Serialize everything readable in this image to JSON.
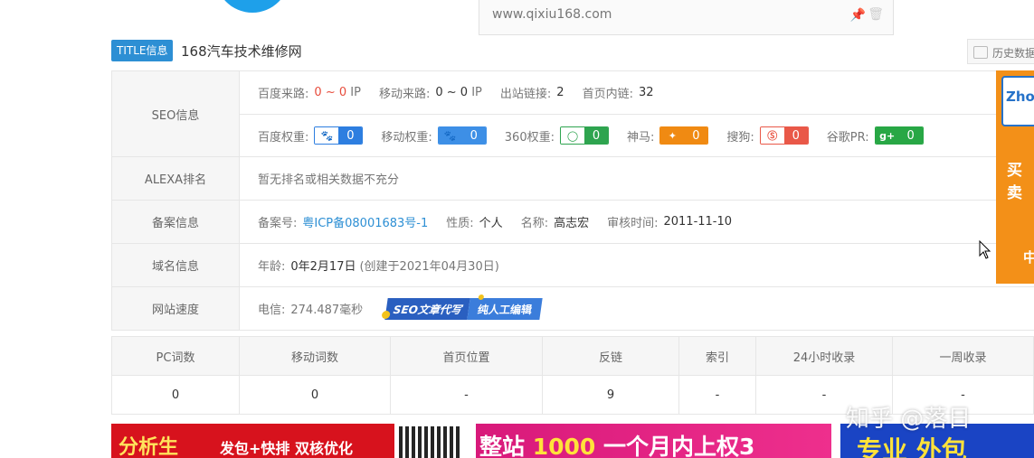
{
  "topbar": {
    "url": "www.qixiu168.com",
    "history_label": "历史数据"
  },
  "title_section": {
    "badge": "TITLE信息",
    "title": "168汽车技术维修网"
  },
  "seo": {
    "label": "SEO信息",
    "baidu_source_label": "百度来路:",
    "baidu_source_from": "0",
    "baidu_source_sep": "~",
    "baidu_source_to": "0",
    "baidu_source_unit": "IP",
    "mobile_source_label": "移动来路:",
    "mobile_source_value": "0 ~ 0",
    "mobile_source_unit": "IP",
    "outlinks_label": "出站链接:",
    "outlinks_value": "2",
    "homepage_links_label": "首页内链:",
    "homepage_links_value": "32",
    "ranks": [
      {
        "label": "百度权重:",
        "value": "0",
        "icon": "baidu-paw-icon"
      },
      {
        "label": "移动权重:",
        "value": "0",
        "icon": "baidu-mobile-paw-icon"
      },
      {
        "label": "360权重:",
        "value": "0",
        "icon": "360-icon"
      },
      {
        "label": "神马:",
        "value": "0",
        "icon": "shenma-icon"
      },
      {
        "label": "搜狗:",
        "value": "0",
        "icon": "sogou-icon"
      },
      {
        "label": "谷歌PR:",
        "value": "0",
        "icon": "google-plus-icon"
      }
    ]
  },
  "alexa": {
    "label": "ALEXA排名",
    "value": "暂无排名或相关数据不充分"
  },
  "icp": {
    "label": "备案信息",
    "number_label": "备案号:",
    "number_value": "粤ICP备08001683号-1",
    "nature_label": "性质:",
    "nature_value": "个人",
    "name_label": "名称:",
    "name_value": "高志宏",
    "review_label": "审核时间:",
    "review_value": "2011-11-10"
  },
  "domain": {
    "label": "域名信息",
    "age_label": "年龄:",
    "age_value": "0年2月17日",
    "created_value": "(创建于2021年04月30日)"
  },
  "speed": {
    "label": "网站速度",
    "telecom_label": "电信:",
    "telecom_value": "274.487毫秒",
    "banner_a": "SEO文章代写",
    "banner_b": "纯人工编辑"
  },
  "right_ad": {
    "logo_text": "Zho",
    "text1": "买卖",
    "text2": "中"
  },
  "stats": {
    "headers": [
      "PC词数",
      "移动词数",
      "首页位置",
      "反链",
      "索引",
      "24小时收录",
      "一周收录"
    ],
    "values": [
      "0",
      "0",
      "-",
      "9",
      "-",
      "-",
      "-"
    ]
  },
  "bottom_ads": {
    "ad1_main": "分析生",
    "ad1_sub": "发包+快排 双核优化",
    "ad2_pre": "整站",
    "ad2_num": "1000",
    "ad2_post": "一个月内上权3",
    "ad3": "专业 外包"
  },
  "watermark": "知乎 @落日",
  "colors": {
    "accent_blue": "#2d8fd4",
    "red": "#e74c3c",
    "orange_ad": "#f39018"
  }
}
